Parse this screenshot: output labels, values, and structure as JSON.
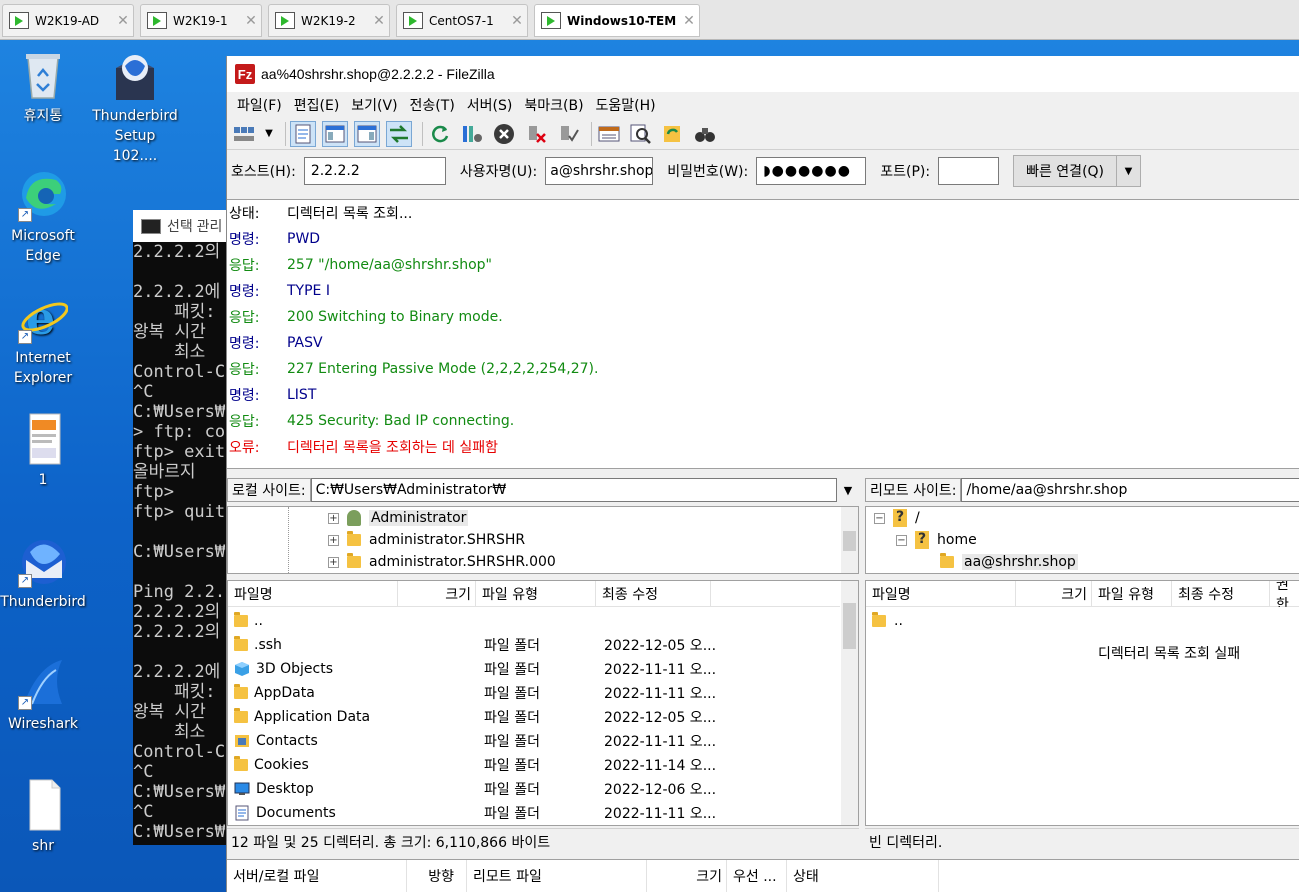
{
  "vm_tabs": [
    {
      "label": "W2K19-AD",
      "active": false
    },
    {
      "label": "W2K19-1",
      "active": false
    },
    {
      "label": "W2K19-2",
      "active": false
    },
    {
      "label": "CentOS7-1",
      "active": false
    },
    {
      "label": "Windows10-TEM",
      "active": true
    }
  ],
  "desktop_icons": {
    "recycle": "휴지통",
    "thunderbird_setup": "Thunderbird Setup 102....",
    "edge": "Microsoft Edge",
    "ie": "Internet Explorer",
    "doc1": "1",
    "thunderbird": "Thunderbird",
    "wireshark": "Wireshark",
    "shr": "shr"
  },
  "console": {
    "title": "선택 관리",
    "lines": [
      "2.2.2.2의",
      "",
      "2.2.2.2에",
      "    패킷:",
      "왕복 시간",
      "    최소",
      "Control-C",
      "^C",
      "C:₩Users₩",
      "> ftp: co",
      "ftp> exit",
      "올바르지",
      "ftp>",
      "ftp> quit",
      "",
      "C:₩Users₩",
      "",
      "Ping 2.2.",
      "2.2.2.2의",
      "2.2.2.2의",
      "",
      "2.2.2.2에",
      "    패킷:",
      "왕복 시간",
      "    최소",
      "Control-C",
      "^C",
      "C:₩Users₩",
      "^C",
      "C:₩Users₩"
    ]
  },
  "filezilla": {
    "title": "aa%40shrshr.shop@2.2.2.2 - FileZilla",
    "logo": "Fz",
    "menu": [
      "파일(F)",
      "편집(E)",
      "보기(V)",
      "전송(T)",
      "서버(S)",
      "북마크(B)",
      "도움말(H)"
    ],
    "quickconnect": {
      "host_label": "호스트(H):",
      "host_value": "2.2.2.2",
      "user_label": "사용자명(U):",
      "user_value": "a@shrshr.shop",
      "pass_label": "비밀번호(W):",
      "pass_value": "◗●●●●●●",
      "port_label": "포트(P):",
      "port_value": "",
      "connect_label": "빠른 연결(Q)"
    },
    "log": [
      {
        "kind": "상태:",
        "text": "디렉터리 목록 조회...",
        "type": "status"
      },
      {
        "kind": "명령:",
        "text": "PWD",
        "type": "cmd"
      },
      {
        "kind": "응답:",
        "text": "257 \"/home/aa@shrshr.shop\"",
        "type": "resp"
      },
      {
        "kind": "명령:",
        "text": "TYPE I",
        "type": "cmd"
      },
      {
        "kind": "응답:",
        "text": "200 Switching to Binary mode.",
        "type": "resp"
      },
      {
        "kind": "명령:",
        "text": "PASV",
        "type": "cmd"
      },
      {
        "kind": "응답:",
        "text": "227 Entering Passive Mode (2,2,2,2,254,27).",
        "type": "resp"
      },
      {
        "kind": "명령:",
        "text": "LIST",
        "type": "cmd"
      },
      {
        "kind": "응답:",
        "text": "425 Security: Bad IP connecting.",
        "type": "resp"
      },
      {
        "kind": "오류:",
        "text": "디렉터리 목록을 조회하는 데 실패함",
        "type": "err"
      }
    ],
    "local": {
      "site_label": "로컬 사이트:",
      "path": "C:₩Users₩Administrator₩",
      "tree": [
        "Administrator",
        "administrator.SHRSHR",
        "administrator.SHRSHR.000"
      ],
      "columns": [
        "파일명",
        "크기",
        "파일 유형",
        "최종 수정"
      ],
      "files": [
        {
          "name": "..",
          "type": "",
          "modified": "",
          "icon": "folder"
        },
        {
          "name": ".ssh",
          "type": "파일 폴더",
          "modified": "2022-12-05 오...",
          "icon": "folder"
        },
        {
          "name": "3D Objects",
          "type": "파일 폴더",
          "modified": "2022-11-11 오...",
          "icon": "cube"
        },
        {
          "name": "AppData",
          "type": "파일 폴더",
          "modified": "2022-11-11 오...",
          "icon": "folder"
        },
        {
          "name": "Application Data",
          "type": "파일 폴더",
          "modified": "2022-12-05 오...",
          "icon": "folder"
        },
        {
          "name": "Contacts",
          "type": "파일 폴더",
          "modified": "2022-11-11 오...",
          "icon": "contacts"
        },
        {
          "name": "Cookies",
          "type": "파일 폴더",
          "modified": "2022-11-14 오...",
          "icon": "folder"
        },
        {
          "name": "Desktop",
          "type": "파일 폴더",
          "modified": "2022-12-06 오...",
          "icon": "desktop"
        },
        {
          "name": "Documents",
          "type": "파일 폴더",
          "modified": "2022-11-11 오...",
          "icon": "doc"
        }
      ],
      "status": "12 파일 및 25 디렉터리. 총 크기: 6,110,866 바이트"
    },
    "remote": {
      "site_label": "리모트 사이트:",
      "path": "/home/aa@shrshr.shop",
      "tree": [
        "/",
        "home",
        "aa@shrshr.shop"
      ],
      "columns": [
        "파일명",
        "크기",
        "파일 유형",
        "최종 수정",
        "권한"
      ],
      "files": [
        {
          "name": ".."
        }
      ],
      "message": "디렉터리 목록 조회 실패",
      "status": "빈 디렉터리."
    },
    "queue_columns": [
      "서버/로컬 파일",
      "방향",
      "리모트 파일",
      "크기",
      "우선 ...",
      "상태"
    ]
  }
}
